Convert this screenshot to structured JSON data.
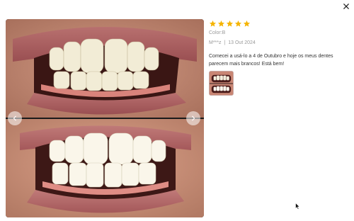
{
  "dialog": {
    "close_icon": "close-icon"
  },
  "gallery": {
    "prev_icon": "chevron-left-icon",
    "next_icon": "chevron-right-icon",
    "images": [
      {
        "name": "teeth-before-photo"
      },
      {
        "name": "teeth-after-photo"
      }
    ]
  },
  "review": {
    "rating": 5,
    "rating_max": 5,
    "star_color": "#f5b400",
    "color_label": "Color:B",
    "author": "M***z",
    "separator": "|",
    "date": "13 Out 2024",
    "text": "Comecei a usá-lo a 4 de Outubro e hoje os meus dentes parecem mais brancos! Está bem!",
    "thumbnail_count": 1
  }
}
